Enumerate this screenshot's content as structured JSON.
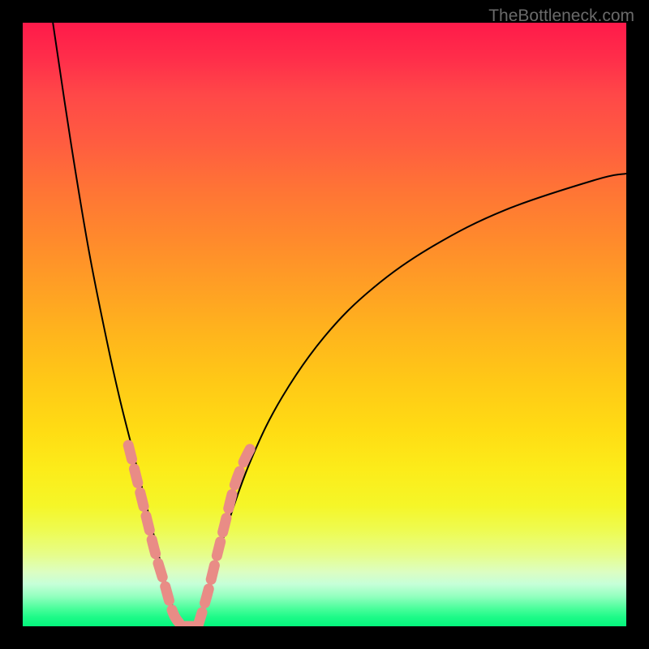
{
  "watermark": "TheBottleneck.com",
  "chart_data": {
    "type": "line",
    "title": "",
    "xlabel": "",
    "ylabel": "",
    "xlim": [
      0,
      100
    ],
    "ylim": [
      0,
      100
    ],
    "note": "Values approximated from pixel positions. Left branch descends steeply from x≈5 at y=100 down to the zero trough; right branch rises from the trough and asymptotes toward y≈75 at the right edge. Both branches touch y=0 around x≈25–29. The 'Poor match' curve segments are two short salmon-colored overlays below y≈30 that straddle the trough. Background gradient runs from red (top) through orange/yellow to green (bottom).",
    "series": [
      {
        "name": "Bottleneck percentage",
        "color": "#000000",
        "left_branch": {
          "x": [
            5,
            8,
            11,
            14,
            16,
            18,
            20,
            22,
            24,
            26
          ],
          "y": [
            100,
            80,
            62,
            47,
            38,
            30,
            22,
            14,
            6,
            0
          ]
        },
        "right_branch": {
          "x": [
            29,
            31,
            34,
            38,
            43,
            50,
            58,
            68,
            80,
            95,
            100
          ],
          "y": [
            0,
            7,
            17,
            28,
            38,
            48,
            56,
            63,
            69,
            74,
            75
          ]
        }
      },
      {
        "name": "Poor match overlay",
        "color": "#e98c86",
        "left_segment": {
          "x": [
            17.5,
            19,
            20.5,
            22,
            23.5,
            25,
            26.5
          ],
          "y": [
            30,
            24,
            18,
            12,
            7,
            2,
            0
          ]
        },
        "right_segment": {
          "x": [
            29,
            30.5,
            32,
            33.5,
            35,
            36.5,
            38
          ],
          "y": [
            0,
            5,
            11,
            17,
            23,
            27,
            30
          ]
        }
      }
    ],
    "background_gradient": {
      "top": "#ff1a4a",
      "mid_high": "#ff8a2c",
      "mid": "#ffdd14",
      "mid_low": "#eefb50",
      "bottom": "#04f57c"
    }
  }
}
